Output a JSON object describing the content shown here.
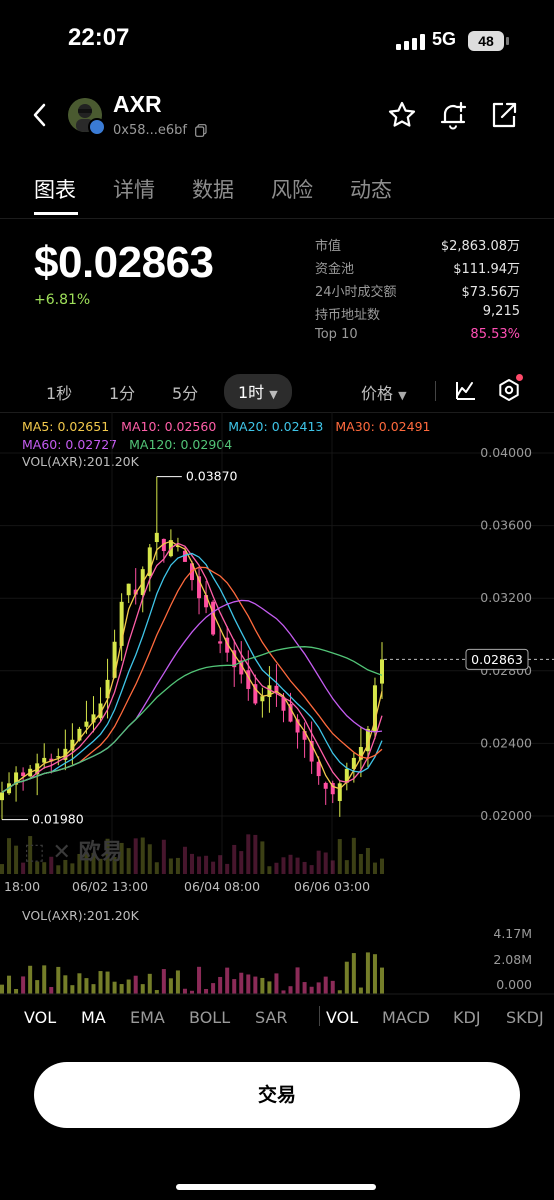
{
  "status": {
    "time": "22:07",
    "network": "5G",
    "battery": "48"
  },
  "token": {
    "name": "AXR",
    "address": "0x58...e6bf"
  },
  "tabs": [
    "图表",
    "详情",
    "数据",
    "风险",
    "动态"
  ],
  "price": {
    "value": "$0.02863",
    "change": "+6.81%"
  },
  "stats": [
    {
      "label": "市值",
      "value": "$2,863.08万"
    },
    {
      "label": "资金池",
      "value": "$111.94万"
    },
    {
      "label": "24小时成交额",
      "value": "$73.56万"
    },
    {
      "label": "持币地址数",
      "value": "9,215"
    },
    {
      "label": "Top 10",
      "value": "85.53%"
    }
  ],
  "intervals": [
    "1秒",
    "1分",
    "5分",
    "1时"
  ],
  "price_toggle": "价格",
  "ma": {
    "ma5": "MA5: 0.02651",
    "ma10": "MA10: 0.02560",
    "ma20": "MA20: 0.02413",
    "ma30": "MA30: 0.02491",
    "ma60": "MA60: 0.02727",
    "ma120": "MA120: 0.02904",
    "vol": "VOL(AXR):201.20K"
  },
  "watermark": "欧易",
  "chart_data": {
    "type": "candlestick",
    "y_ticks": [
      "0.04000",
      "0.03600",
      "0.03200",
      "0.02800",
      "0.02400",
      "0.02000"
    ],
    "y_tick_values": [
      0.04,
      0.036,
      0.032,
      0.028,
      0.024,
      0.02
    ],
    "x_ticks": [
      "18:00",
      "06/02 13:00",
      "06/04 08:00",
      "06/06 03:00"
    ],
    "high_label": "0.03870",
    "low_label": "0.01980",
    "current_label": "0.02863",
    "current_value": 0.02863,
    "high_value": 0.0387,
    "low_value": 0.0198,
    "close_path": [
      0.0213,
      0.0218,
      0.0224,
      0.0222,
      0.0226,
      0.0229,
      0.0232,
      0.023,
      0.0233,
      0.0237,
      0.0242,
      0.0248,
      0.0252,
      0.0256,
      0.0262,
      0.0275,
      0.0296,
      0.0318,
      0.0328,
      0.0322,
      0.0336,
      0.0348,
      0.0356,
      0.0346,
      0.0352,
      0.0349,
      0.034,
      0.033,
      0.032,
      0.0315,
      0.03,
      0.0295,
      0.029,
      0.0282,
      0.0278,
      0.027,
      0.0262,
      0.0266,
      0.0272,
      0.0268,
      0.0258,
      0.0252,
      0.0246,
      0.0242,
      0.023,
      0.0222,
      0.0215,
      0.0212,
      0.0218,
      0.0226,
      0.0232,
      0.0238,
      0.0248,
      0.0272,
      0.02863
    ],
    "volume_ticks": [
      "4.17M",
      "2.08M",
      "0.000"
    ],
    "volume_label": "VOL(AXR):201.20K"
  },
  "indicators_main": [
    "VOL",
    "MA",
    "EMA",
    "BOLL",
    "SAR"
  ],
  "indicators_sub": [
    "VOL",
    "MACD",
    "KDJ",
    "SKDJ"
  ],
  "trade_button": "交易"
}
